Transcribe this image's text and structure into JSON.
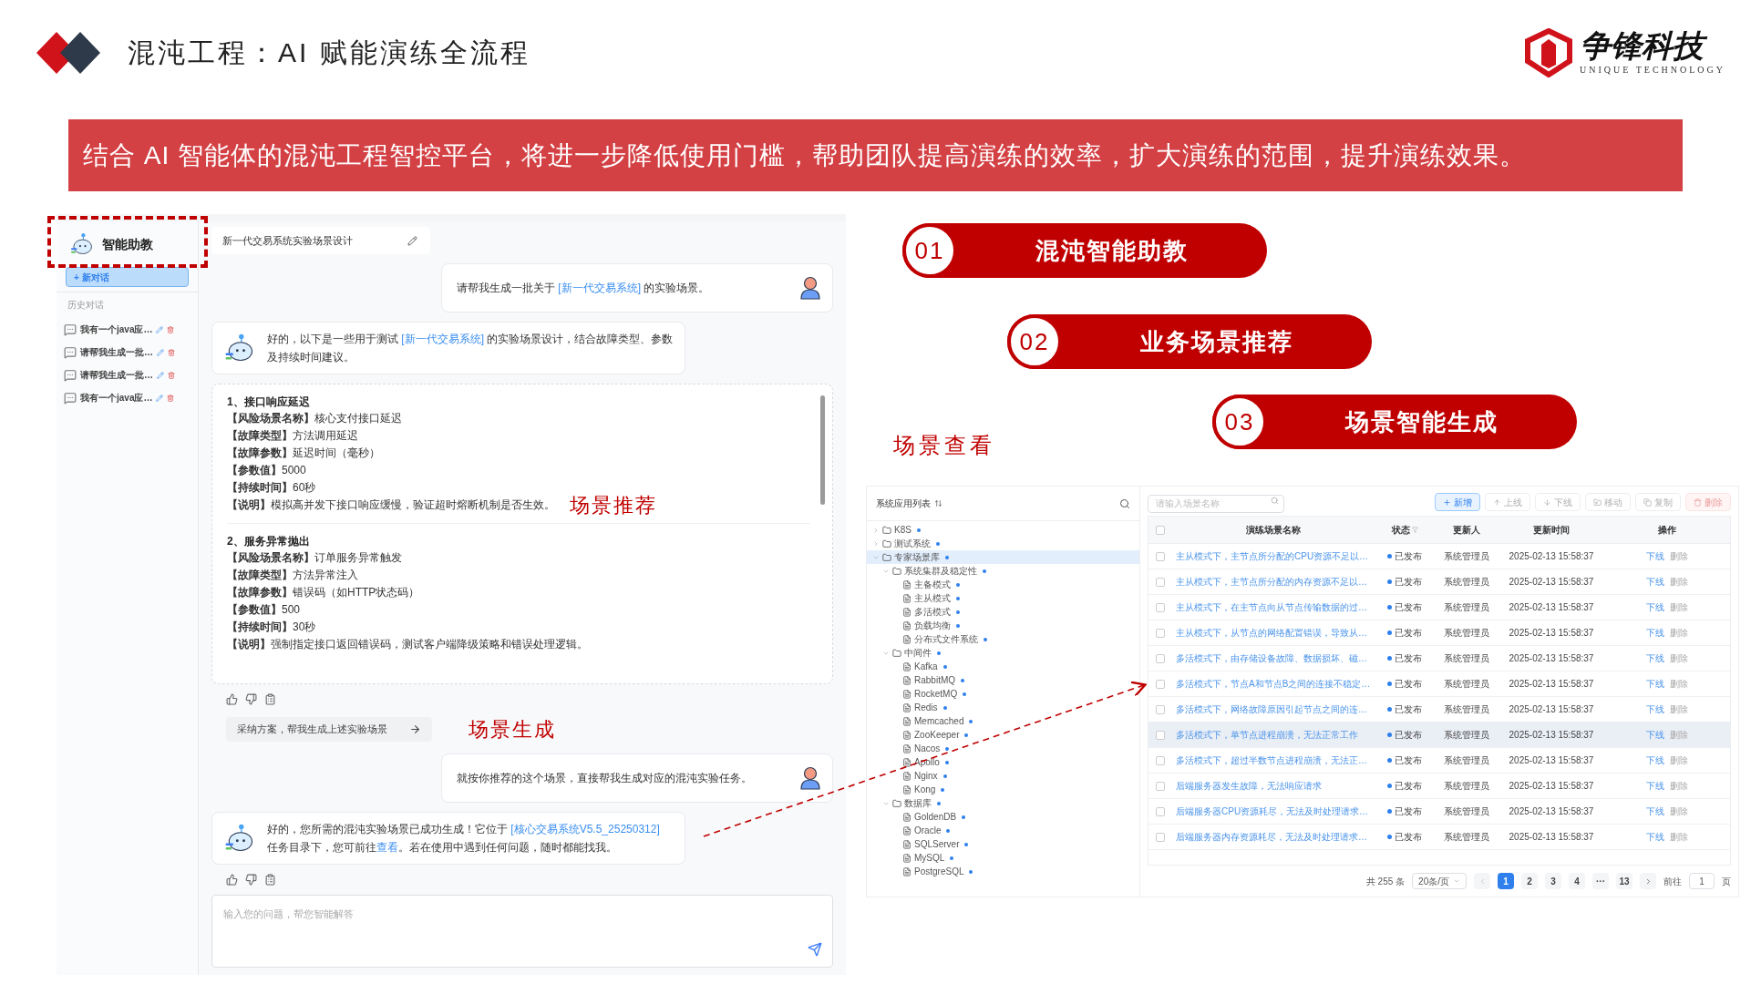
{
  "slide": {
    "title": "混沌工程：AI 赋能演练全流程",
    "brand": {
      "name": "争锋科技",
      "tagline": "UNIQUE TECHNOLOGY"
    },
    "banner": "结合 AI 智能体的混沌工程智控平台，将进一步降低使用门槛，帮助团队提高演练的效率，扩大演练的范围，提升演练效果。"
  },
  "assistant": {
    "sidebar": {
      "title": "智能助教",
      "new_chat": "+ 新对话",
      "history_label": "历史对话",
      "history": [
        {
          "label": "我有一个java应…"
        },
        {
          "label": "请帮我生成一批…"
        },
        {
          "label": "请帮我生成一批…"
        },
        {
          "label": "我有一个java应…"
        }
      ]
    },
    "chat": {
      "title": "新一代交易系统实验场景设计",
      "messages": [
        {
          "kind": "user",
          "parts": [
            {
              "kind": "text",
              "text": "请帮我生成一批关于 "
            },
            {
              "kind": "link",
              "text": "[新一代交易系统]"
            },
            {
              "kind": "text",
              "text": " 的实验场景。"
            }
          ]
        },
        {
          "kind": "bot",
          "parts": [
            {
              "kind": "text",
              "text": "好的，以下是一些用于测试 "
            },
            {
              "kind": "link",
              "text": "[新一代交易系统]"
            },
            {
              "kind": "text",
              "text": " 的实验场景设计，结合故障类型、参数及持续时间建议。"
            }
          ]
        },
        {
          "kind": "scenarios",
          "items": [
            {
              "title": "1、接口响应延迟",
              "annotation": "场景推荐",
              "fields": [
                {
                  "label": "【风险场景名称】",
                  "value": "核心支付接口延迟"
                },
                {
                  "label": "【故障类型】",
                  "value": "方法调用延迟"
                },
                {
                  "label": "【故障参数】",
                  "value": "延迟时间（毫秒）"
                },
                {
                  "label": "【参数值】",
                  "value": "5000"
                },
                {
                  "label": "【持续时间】",
                  "value": "60秒"
                },
                {
                  "label": "【说明】",
                  "value": "模拟高并发下接口响应缓慢，验证超时熔断机制是否生效。"
                }
              ]
            },
            {
              "title": "2、服务异常抛出",
              "fields": [
                {
                  "label": "【风险场景名称】",
                  "value": "订单服务异常触发"
                },
                {
                  "label": "【故障类型】",
                  "value": "方法异常注入"
                },
                {
                  "label": "【故障参数】",
                  "value": "错误码（如HTTP状态码）"
                },
                {
                  "label": "【参数值】",
                  "value": "500"
                },
                {
                  "label": "【持续时间】",
                  "value": "30秒"
                },
                {
                  "label": "【说明】",
                  "value": "强制指定接口返回错误码，测试客户端降级策略和错误处理逻辑。"
                }
              ]
            }
          ]
        },
        {
          "kind": "feedback"
        },
        {
          "kind": "suggestion",
          "text": "采纳方案，帮我生成上述实验场景",
          "annotation": "场景生成"
        },
        {
          "kind": "user",
          "parts": [
            {
              "kind": "text",
              "text": "就按你推荐的这个场景，直接帮我生成对应的混沌实验任务。"
            }
          ]
        },
        {
          "kind": "bot",
          "parts": [
            {
              "kind": "text",
              "text": "好的，您所需的混沌实验场景已成功生成！它位于 "
            },
            {
              "kind": "link",
              "text": "[核心交易系统V5.5_25250312]"
            },
            {
              "kind": "text",
              "text": " 任务目录下，您可前往"
            },
            {
              "kind": "link",
              "text": "查看"
            },
            {
              "kind": "text",
              "text": "。若在使用中遇到任何问题，随时都能找我。"
            }
          ]
        },
        {
          "kind": "feedback"
        }
      ],
      "input": {
        "placeholder": "输入您的问题，帮您智能解答"
      }
    }
  },
  "features": [
    {
      "number": "01",
      "label": "混沌智能助教"
    },
    {
      "number": "02",
      "label": "业务场景推荐"
    },
    {
      "number": "03",
      "label": "场景智能生成"
    }
  ],
  "view_label": "场景查看",
  "scene_list": {
    "tree_title": "系统应用列表",
    "tree": [
      {
        "label": "K8S",
        "kind": "folder",
        "expanded": false,
        "selected": false
      },
      {
        "label": "测试系统",
        "kind": "folder",
        "expanded": false,
        "selected": false
      },
      {
        "label": "专家场景库",
        "kind": "folder",
        "expanded": true,
        "selected": true,
        "children": [
          {
            "label": "系统集群及稳定性",
            "kind": "folder",
            "expanded": true,
            "selected": false,
            "children": [
              {
                "label": "主备模式",
                "kind": "file",
                "selected": false
              },
              {
                "label": "主从模式",
                "kind": "file",
                "selected": false
              },
              {
                "label": "多活模式",
                "kind": "file",
                "selected": false
              },
              {
                "label": "负载均衡",
                "kind": "file",
                "selected": false
              },
              {
                "label": "分布式文件系统",
                "kind": "file",
                "selected": false
              }
            ]
          },
          {
            "label": "中间件",
            "kind": "folder",
            "expanded": true,
            "selected": false,
            "children": [
              {
                "label": "Kafka",
                "kind": "file",
                "selected": false
              },
              {
                "label": "RabbitMQ",
                "kind": "file",
                "selected": false
              },
              {
                "label": "RocketMQ",
                "kind": "file",
                "selected": false
              },
              {
                "label": "Redis",
                "kind": "file",
                "selected": false
              },
              {
                "label": "Memcached",
                "kind": "file",
                "selected": false
              },
              {
                "label": "ZooKeeper",
                "kind": "file",
                "selected": false
              },
              {
                "label": "Nacos",
                "kind": "file",
                "selected": false
              },
              {
                "label": "Apollo",
                "kind": "file",
                "selected": false
              },
              {
                "label": "Nginx",
                "kind": "file",
                "selected": false
              },
              {
                "label": "Kong",
                "kind": "file",
                "selected": false
              }
            ]
          },
          {
            "label": "数据库",
            "kind": "folder",
            "expanded": true,
            "selected": false,
            "children": [
              {
                "label": "GoldenDB",
                "kind": "file",
                "selected": false
              },
              {
                "label": "Oracle",
                "kind": "file",
                "selected": false
              },
              {
                "label": "SQLServer",
                "kind": "file",
                "selected": false
              },
              {
                "label": "MySQL",
                "kind": "file",
                "selected": false
              },
              {
                "label": "PostgreSQL",
                "kind": "file",
                "selected": false
              }
            ]
          }
        ]
      }
    ],
    "search": {
      "placeholder": "请输入场景名称"
    },
    "toolbar": [
      {
        "label": "新增",
        "kind": "primary",
        "disabled": false
      },
      {
        "label": "上线",
        "kind": "default",
        "disabled": true
      },
      {
        "label": "下线",
        "kind": "default",
        "disabled": true
      },
      {
        "label": "移动",
        "kind": "default",
        "disabled": true
      },
      {
        "label": "复制",
        "kind": "default",
        "disabled": true
      },
      {
        "label": "删除",
        "kind": "danger",
        "disabled": true
      }
    ],
    "select_all": {
      "checked": false
    },
    "columns": [
      "演练场景名称",
      "状态",
      "更新人",
      "更新时间",
      "操作"
    ],
    "rows": [
      {
        "name": "主从模式下，主节点所分配的CPU资源不足以…",
        "status": "已发布",
        "updater": "系统管理员",
        "time": "2025-02-13 15:58:37",
        "actions": [
          "下线",
          "删除"
        ],
        "selected": false,
        "checked": false
      },
      {
        "name": "主从模式下，主节点所分配的内存资源不足以…",
        "status": "已发布",
        "updater": "系统管理员",
        "time": "2025-02-13 15:58:37",
        "actions": [
          "下线",
          "删除"
        ],
        "selected": false,
        "checked": false
      },
      {
        "name": "主从模式下，在主节点向从节点传输数据的过…",
        "status": "已发布",
        "updater": "系统管理员",
        "time": "2025-02-13 15:58:37",
        "actions": [
          "下线",
          "删除"
        ],
        "selected": false,
        "checked": false
      },
      {
        "name": "主从模式下，从节点的网络配置错误，导致从…",
        "status": "已发布",
        "updater": "系统管理员",
        "time": "2025-02-13 15:58:37",
        "actions": [
          "下线",
          "删除"
        ],
        "selected": false,
        "checked": false
      },
      {
        "name": "多活模式下，由存储设备故障、数据损坏、磁…",
        "status": "已发布",
        "updater": "系统管理员",
        "time": "2025-02-13 15:58:37",
        "actions": [
          "下线",
          "删除"
        ],
        "selected": false,
        "checked": false
      },
      {
        "name": "多活模式下，节点A和节点B之间的连接不稳定…",
        "status": "已发布",
        "updater": "系统管理员",
        "time": "2025-02-13 15:58:37",
        "actions": [
          "下线",
          "删除"
        ],
        "selected": false,
        "checked": false
      },
      {
        "name": "多活模式下，网络故障原因引起节点之间的连…",
        "status": "已发布",
        "updater": "系统管理员",
        "time": "2025-02-13 15:58:37",
        "actions": [
          "下线",
          "删除"
        ],
        "selected": false,
        "checked": false
      },
      {
        "name": "多活模式下，单节点进程崩溃，无法正常工作",
        "status": "已发布",
        "updater": "系统管理员",
        "time": "2025-02-13 15:58:37",
        "actions": [
          "下线",
          "删除"
        ],
        "selected": true,
        "checked": false
      },
      {
        "name": "多活模式下，超过半数节点进程崩溃，无法正…",
        "status": "已发布",
        "updater": "系统管理员",
        "time": "2025-02-13 15:58:37",
        "actions": [
          "下线",
          "删除"
        ],
        "selected": false,
        "checked": false
      },
      {
        "name": "后端服务器发生故障，无法响应请求",
        "status": "已发布",
        "updater": "系统管理员",
        "time": "2025-02-13 15:58:37",
        "actions": [
          "下线",
          "删除"
        ],
        "selected": false,
        "checked": false
      },
      {
        "name": "后端服务器CPU资源耗尽，无法及时处理请求…",
        "status": "已发布",
        "updater": "系统管理员",
        "time": "2025-02-13 15:58:37",
        "actions": [
          "下线",
          "删除"
        ],
        "selected": false,
        "checked": false
      },
      {
        "name": "后端服务器内存资源耗尽，无法及时处理请求…",
        "status": "已发布",
        "updater": "系统管理员",
        "time": "2025-02-13 15:58:37",
        "actions": [
          "下线",
          "删除"
        ],
        "selected": false,
        "checked": false
      }
    ],
    "pagination": {
      "total": "共 255 条",
      "page_size": "20条/页",
      "pages": [
        {
          "label": "1",
          "selected": true
        },
        {
          "label": "2",
          "selected": false
        },
        {
          "label": "3",
          "selected": false
        },
        {
          "label": "4",
          "selected": false
        },
        {
          "label": "···",
          "selected": false
        },
        {
          "label": "13",
          "selected": false
        }
      ],
      "goto_label": "前往",
      "goto_value": "1",
      "goto_unit": "页"
    }
  }
}
